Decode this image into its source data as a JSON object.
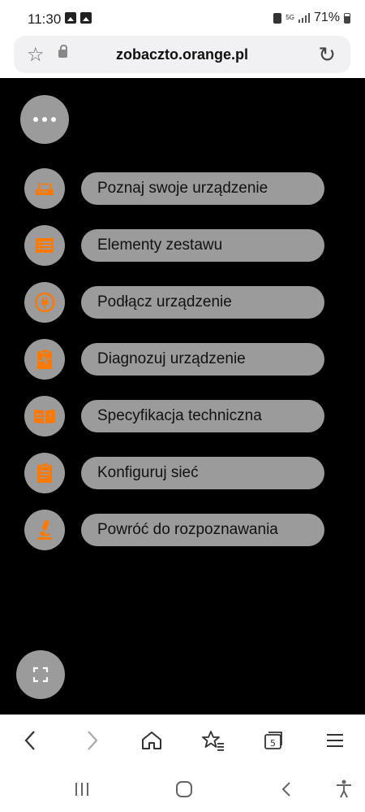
{
  "status_bar": {
    "time": "11:30",
    "network": "5G",
    "battery": "71%",
    "left_icons": [
      "gallery-icon",
      "qr-icon"
    ],
    "right_icons": [
      "lock-icon",
      "5g-icon",
      "signal-icon",
      "battery-icon"
    ]
  },
  "browser": {
    "url": "zobaczto.orange.pl",
    "tab_count": "5"
  },
  "menu": {
    "items": [
      {
        "label": "Poznaj swoje urządzenie",
        "icon": "router-icon"
      },
      {
        "label": "Elementy zestawu",
        "icon": "list-icon"
      },
      {
        "label": "Podłącz urządzenie",
        "icon": "plug-icon"
      },
      {
        "label": "Diagnozuj urządzenie",
        "icon": "diagnostics-clipboard-icon"
      },
      {
        "label": "Specyfikacja techniczna",
        "icon": "spec-book-icon"
      },
      {
        "label": "Konfiguruj sieć",
        "icon": "clipboard-icon"
      },
      {
        "label": "Powróć do rozpoznawania",
        "icon": "microscope-icon"
      }
    ]
  },
  "colors": {
    "background": "#000000",
    "button_gray": "#9b9b9b",
    "icon_orange": "#ff7900"
  }
}
